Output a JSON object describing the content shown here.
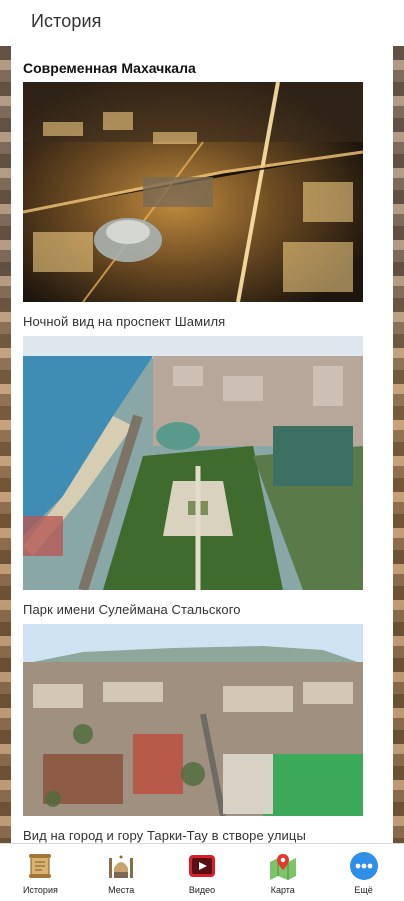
{
  "header": {
    "title": "История"
  },
  "section": {
    "title": "Современная Махачкала"
  },
  "gallery": [
    {
      "caption": "Ночной вид на проспект Шамиля",
      "photo_icon": "night-city-photo"
    },
    {
      "caption": "Парк имени Сулеймана Стальского",
      "photo_icon": "park-aerial-photo"
    },
    {
      "caption": "Вид на город и гору Тарки-Тау в створе улицы",
      "photo_icon": "city-mountain-photo"
    }
  ],
  "nav": {
    "items": [
      {
        "label": "История",
        "icon": "scroll-icon"
      },
      {
        "label": "Места",
        "icon": "mosque-icon"
      },
      {
        "label": "Видео",
        "icon": "youtube-icon"
      },
      {
        "label": "Карта",
        "icon": "map-pin-icon"
      },
      {
        "label": "Ещё",
        "icon": "more-dots-icon"
      }
    ]
  },
  "colors": {
    "more_accent": "#2f8fe6",
    "video_red": "#d8202a",
    "map_pin": "#e23b2e"
  }
}
